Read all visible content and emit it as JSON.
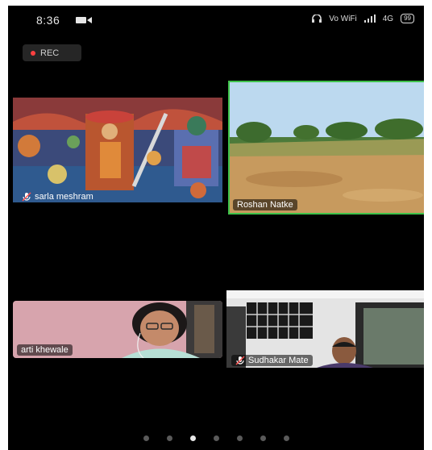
{
  "status_bar": {
    "time": "8:36",
    "icons": [
      "video-camera-icon",
      "headset-icon",
      "vowifi-icon",
      "signal-icon",
      "battery-icon"
    ],
    "net_label": "Vo WiFi",
    "signal_label": "4G",
    "battery": "99"
  },
  "recording": {
    "label": "REC",
    "color": "#ff4040"
  },
  "participants": [
    {
      "name": "sarla meshram",
      "muted": true,
      "active_speaker": false
    },
    {
      "name": "Roshan Natke",
      "muted": false,
      "active_speaker": true,
      "highlight_color": "#3ec24a"
    },
    {
      "name": "arti khewale",
      "muted": false,
      "active_speaker": false
    },
    {
      "name": "Sudhakar Mate",
      "muted": true,
      "active_speaker": false
    }
  ],
  "pager": {
    "count": 7,
    "active_index": 2
  }
}
